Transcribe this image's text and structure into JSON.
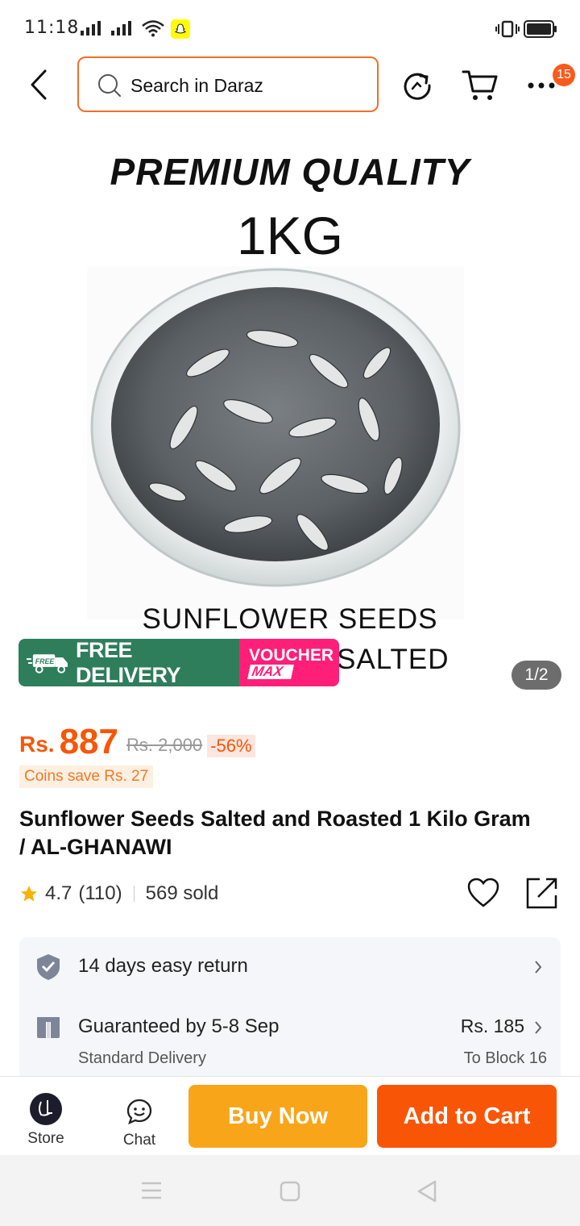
{
  "status_bar": {
    "time": "11:18"
  },
  "search": {
    "placeholder": "Search in Daraz"
  },
  "cart": {
    "badge": "15"
  },
  "hero": {
    "line1": "PREMIUM QUALITY",
    "line2": "1KG",
    "line3": "SUNFLOWER SEEDS",
    "line4": "SALTED",
    "pager": "1/2"
  },
  "promo": {
    "free_tag": "FREE",
    "free_delivery": "FREE DELIVERY",
    "voucher": "VOUCHER",
    "max": "MAX"
  },
  "price": {
    "currency": "Rs.",
    "amount": "887",
    "original": "Rs. 2,000",
    "discount": "-56%",
    "coins": "Coins save Rs. 27"
  },
  "product": {
    "title": "Sunflower Seeds Salted and Roasted 1 Kilo Gram / AL-GHANAWI",
    "rating": "4.7",
    "reviews": "(110)",
    "sold": "569 sold"
  },
  "services": {
    "return": "14 days easy return",
    "delivery": "Guaranteed by 5-8 Sep",
    "delivery_type": "Standard Delivery",
    "delivery_price": "Rs. 185",
    "delivery_to": "To Block 16"
  },
  "bottom_bar": {
    "store": "Store",
    "chat": "Chat",
    "buy_now": "Buy Now",
    "add_to_cart": "Add to Cart",
    "buy_color": "#f9a51a",
    "cart_color": "#f85606"
  }
}
